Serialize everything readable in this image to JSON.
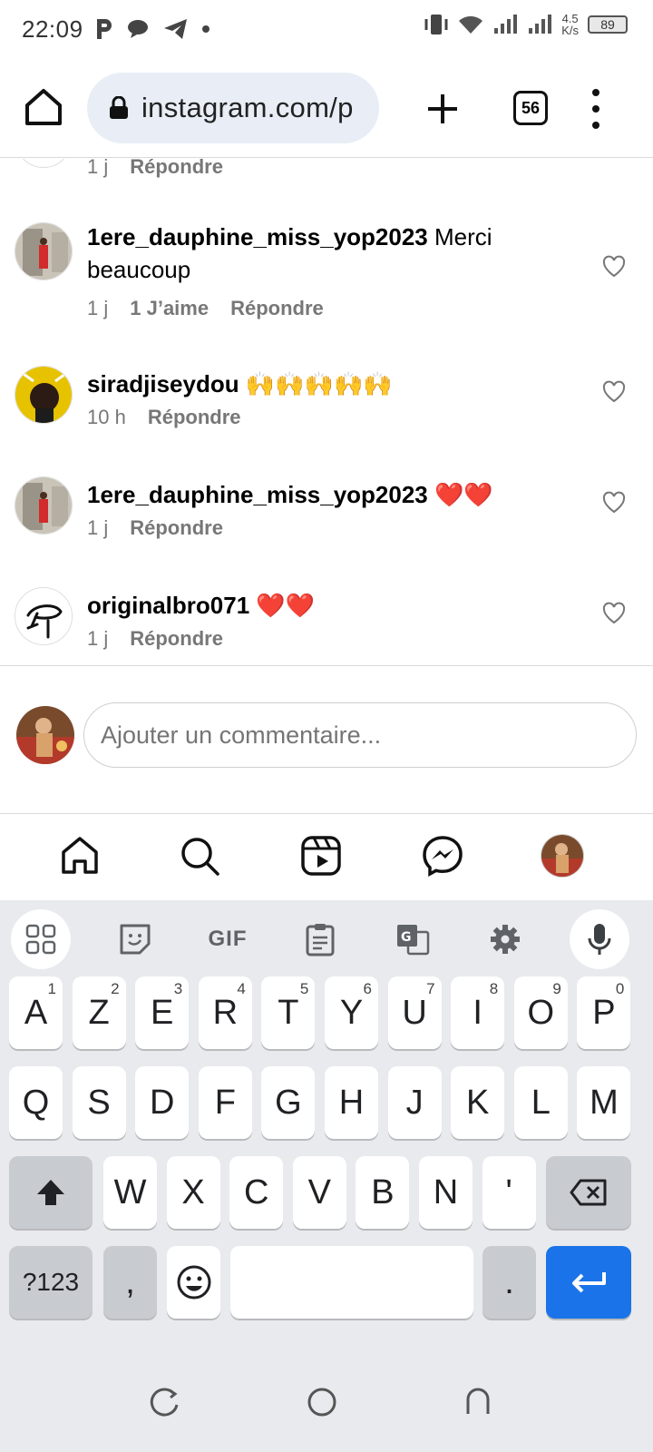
{
  "status_bar": {
    "time": "22:09",
    "net_speed_value": "4.5",
    "net_speed_unit": "K/s",
    "battery": "89"
  },
  "browser": {
    "url": "instagram.com/p",
    "tab_count": "56"
  },
  "comments": [
    {
      "username": "",
      "text": "",
      "time": "1 j",
      "likes": "",
      "reply": "Répondre"
    },
    {
      "username": "1ere_dauphine_miss_yop2023",
      "text": "Merci beaucoup",
      "time": "1 j",
      "likes": "1 J’aime",
      "reply": "Répondre"
    },
    {
      "username": "siradjiseydou",
      "text": "🙌🙌🙌🙌🙌",
      "time": "10 h",
      "likes": "",
      "reply": "Répondre"
    },
    {
      "username": "1ere_dauphine_miss_yop2023",
      "text": "❤️❤️",
      "time": "1 j",
      "likes": "",
      "reply": "Répondre"
    },
    {
      "username": "originalbro071",
      "text": "❤️❤️",
      "time": "1 j",
      "likes": "",
      "reply": "Répondre"
    }
  ],
  "comment_input": {
    "placeholder": "Ajouter un commentaire..."
  },
  "keyboard": {
    "toolbar_gif": "GIF",
    "row1": [
      {
        "letter": "A",
        "num": "1"
      },
      {
        "letter": "Z",
        "num": "2"
      },
      {
        "letter": "E",
        "num": "3"
      },
      {
        "letter": "R",
        "num": "4"
      },
      {
        "letter": "T",
        "num": "5"
      },
      {
        "letter": "Y",
        "num": "6"
      },
      {
        "letter": "U",
        "num": "7"
      },
      {
        "letter": "I",
        "num": "8"
      },
      {
        "letter": "O",
        "num": "9"
      },
      {
        "letter": "P",
        "num": "0"
      }
    ],
    "row2": [
      "Q",
      "S",
      "D",
      "F",
      "G",
      "H",
      "J",
      "K",
      "L",
      "M"
    ],
    "row3": [
      "W",
      "X",
      "C",
      "V",
      "B",
      "N",
      "'"
    ],
    "symbols_label": "?123",
    "comma": ",",
    "period": "."
  },
  "colors": {
    "accent_blue": "#1a73e8",
    "url_bg": "#e8edf6",
    "keyboard_bg": "#e8eaed",
    "heart_red": "#e0245e"
  }
}
